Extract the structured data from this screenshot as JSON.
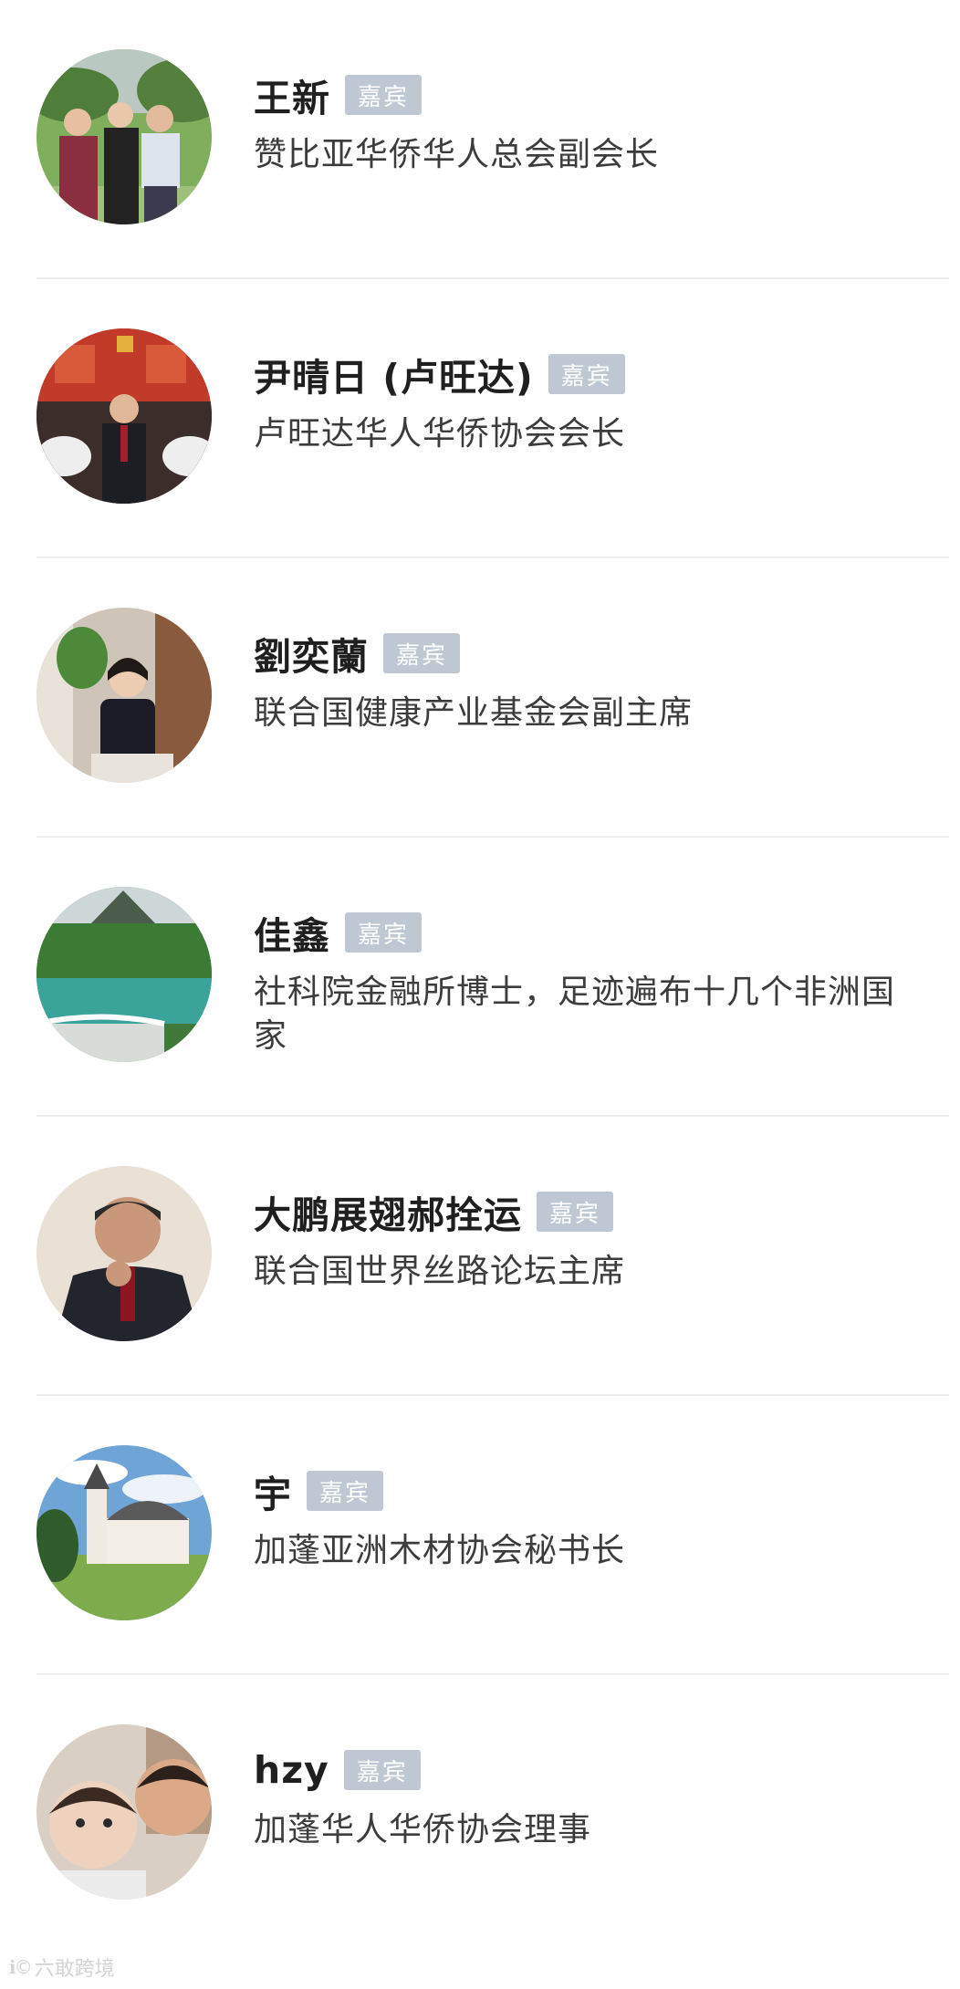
{
  "badge_label": "嘉宾",
  "guests": [
    {
      "name": "王新",
      "title": "赞比亚华侨华人总会副会长",
      "avatar": "family-outdoor-photo"
    },
    {
      "name": "尹晴日 (卢旺达)",
      "title": "卢旺达华人华侨协会会长",
      "avatar": "banquet-hall-photo"
    },
    {
      "name": "劉奕蘭",
      "title": "联合国健康产业基金会副主席",
      "avatar": "woman-portrait-photo"
    },
    {
      "name": "佳鑫",
      "title": "社科院金融所博士，足迹遍布十几个非洲国家",
      "avatar": "lake-waterfall-photo"
    },
    {
      "name": "大鹏展翅郝拴运",
      "title": "联合国世界丝路论坛主席",
      "avatar": "man-portrait-photo"
    },
    {
      "name": "宇",
      "title": "加蓬亚洲木材协会秘书长",
      "avatar": "church-landscape-photo"
    },
    {
      "name": "hzy",
      "title": "加蓬华人华侨协会理事",
      "avatar": "children-photo"
    }
  ],
  "watermark": {
    "icon": "ico-logo",
    "text": "六敢跨境"
  },
  "colors": {
    "badge_bg": "#bfc8d2",
    "name": "#1f1f1f",
    "title": "#3c3c3c",
    "divider": "#eeeeee"
  }
}
